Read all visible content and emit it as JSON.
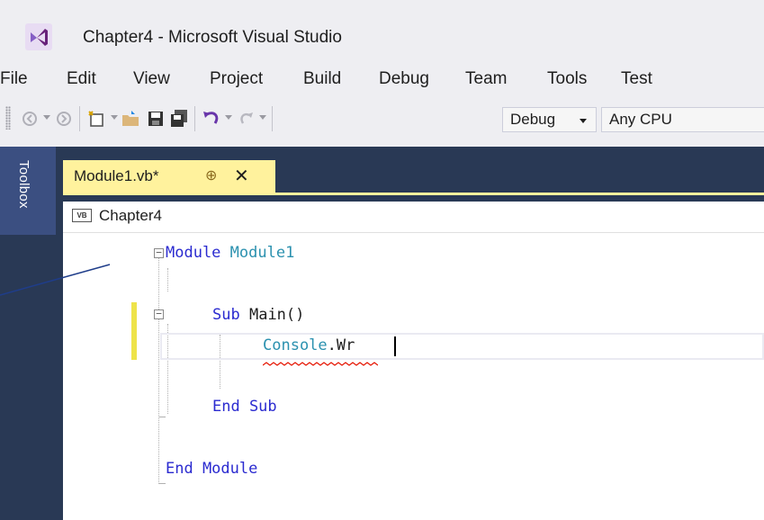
{
  "window": {
    "title": "Chapter4 - Microsoft Visual Studio"
  },
  "menu": {
    "items": [
      {
        "label": "File"
      },
      {
        "label": "Edit"
      },
      {
        "label": "View"
      },
      {
        "label": "Project"
      },
      {
        "label": "Build"
      },
      {
        "label": "Debug"
      },
      {
        "label": "Team"
      },
      {
        "label": "Tools"
      },
      {
        "label": "Test"
      }
    ]
  },
  "toolbar": {
    "config_value": "Debug",
    "platform_value": "Any CPU",
    "icons": [
      "back-icon",
      "forward-icon",
      "new-project-icon",
      "open-icon",
      "save-icon",
      "save-all-icon",
      "undo-icon",
      "redo-icon"
    ]
  },
  "toolbox": {
    "label": "Toolbox"
  },
  "tab": {
    "name": "Module1.vb*",
    "pin": "⊕",
    "close": "✕"
  },
  "nav": {
    "project": "Chapter4",
    "badge": "VB"
  },
  "code": {
    "line1_kw": "Module",
    "line1_name": "Module1",
    "line2_kw": "Sub",
    "line2_rest": "Main()",
    "line3_type": "Console",
    "line3_rest": ".Wr",
    "line4": "End Sub",
    "line5": "End Module"
  },
  "colors": {
    "accent_tab": "#fff29d",
    "dark_band": "#293955",
    "keyword": "#0000ff",
    "type": "#2b91af",
    "squiggle": "#e51400"
  }
}
